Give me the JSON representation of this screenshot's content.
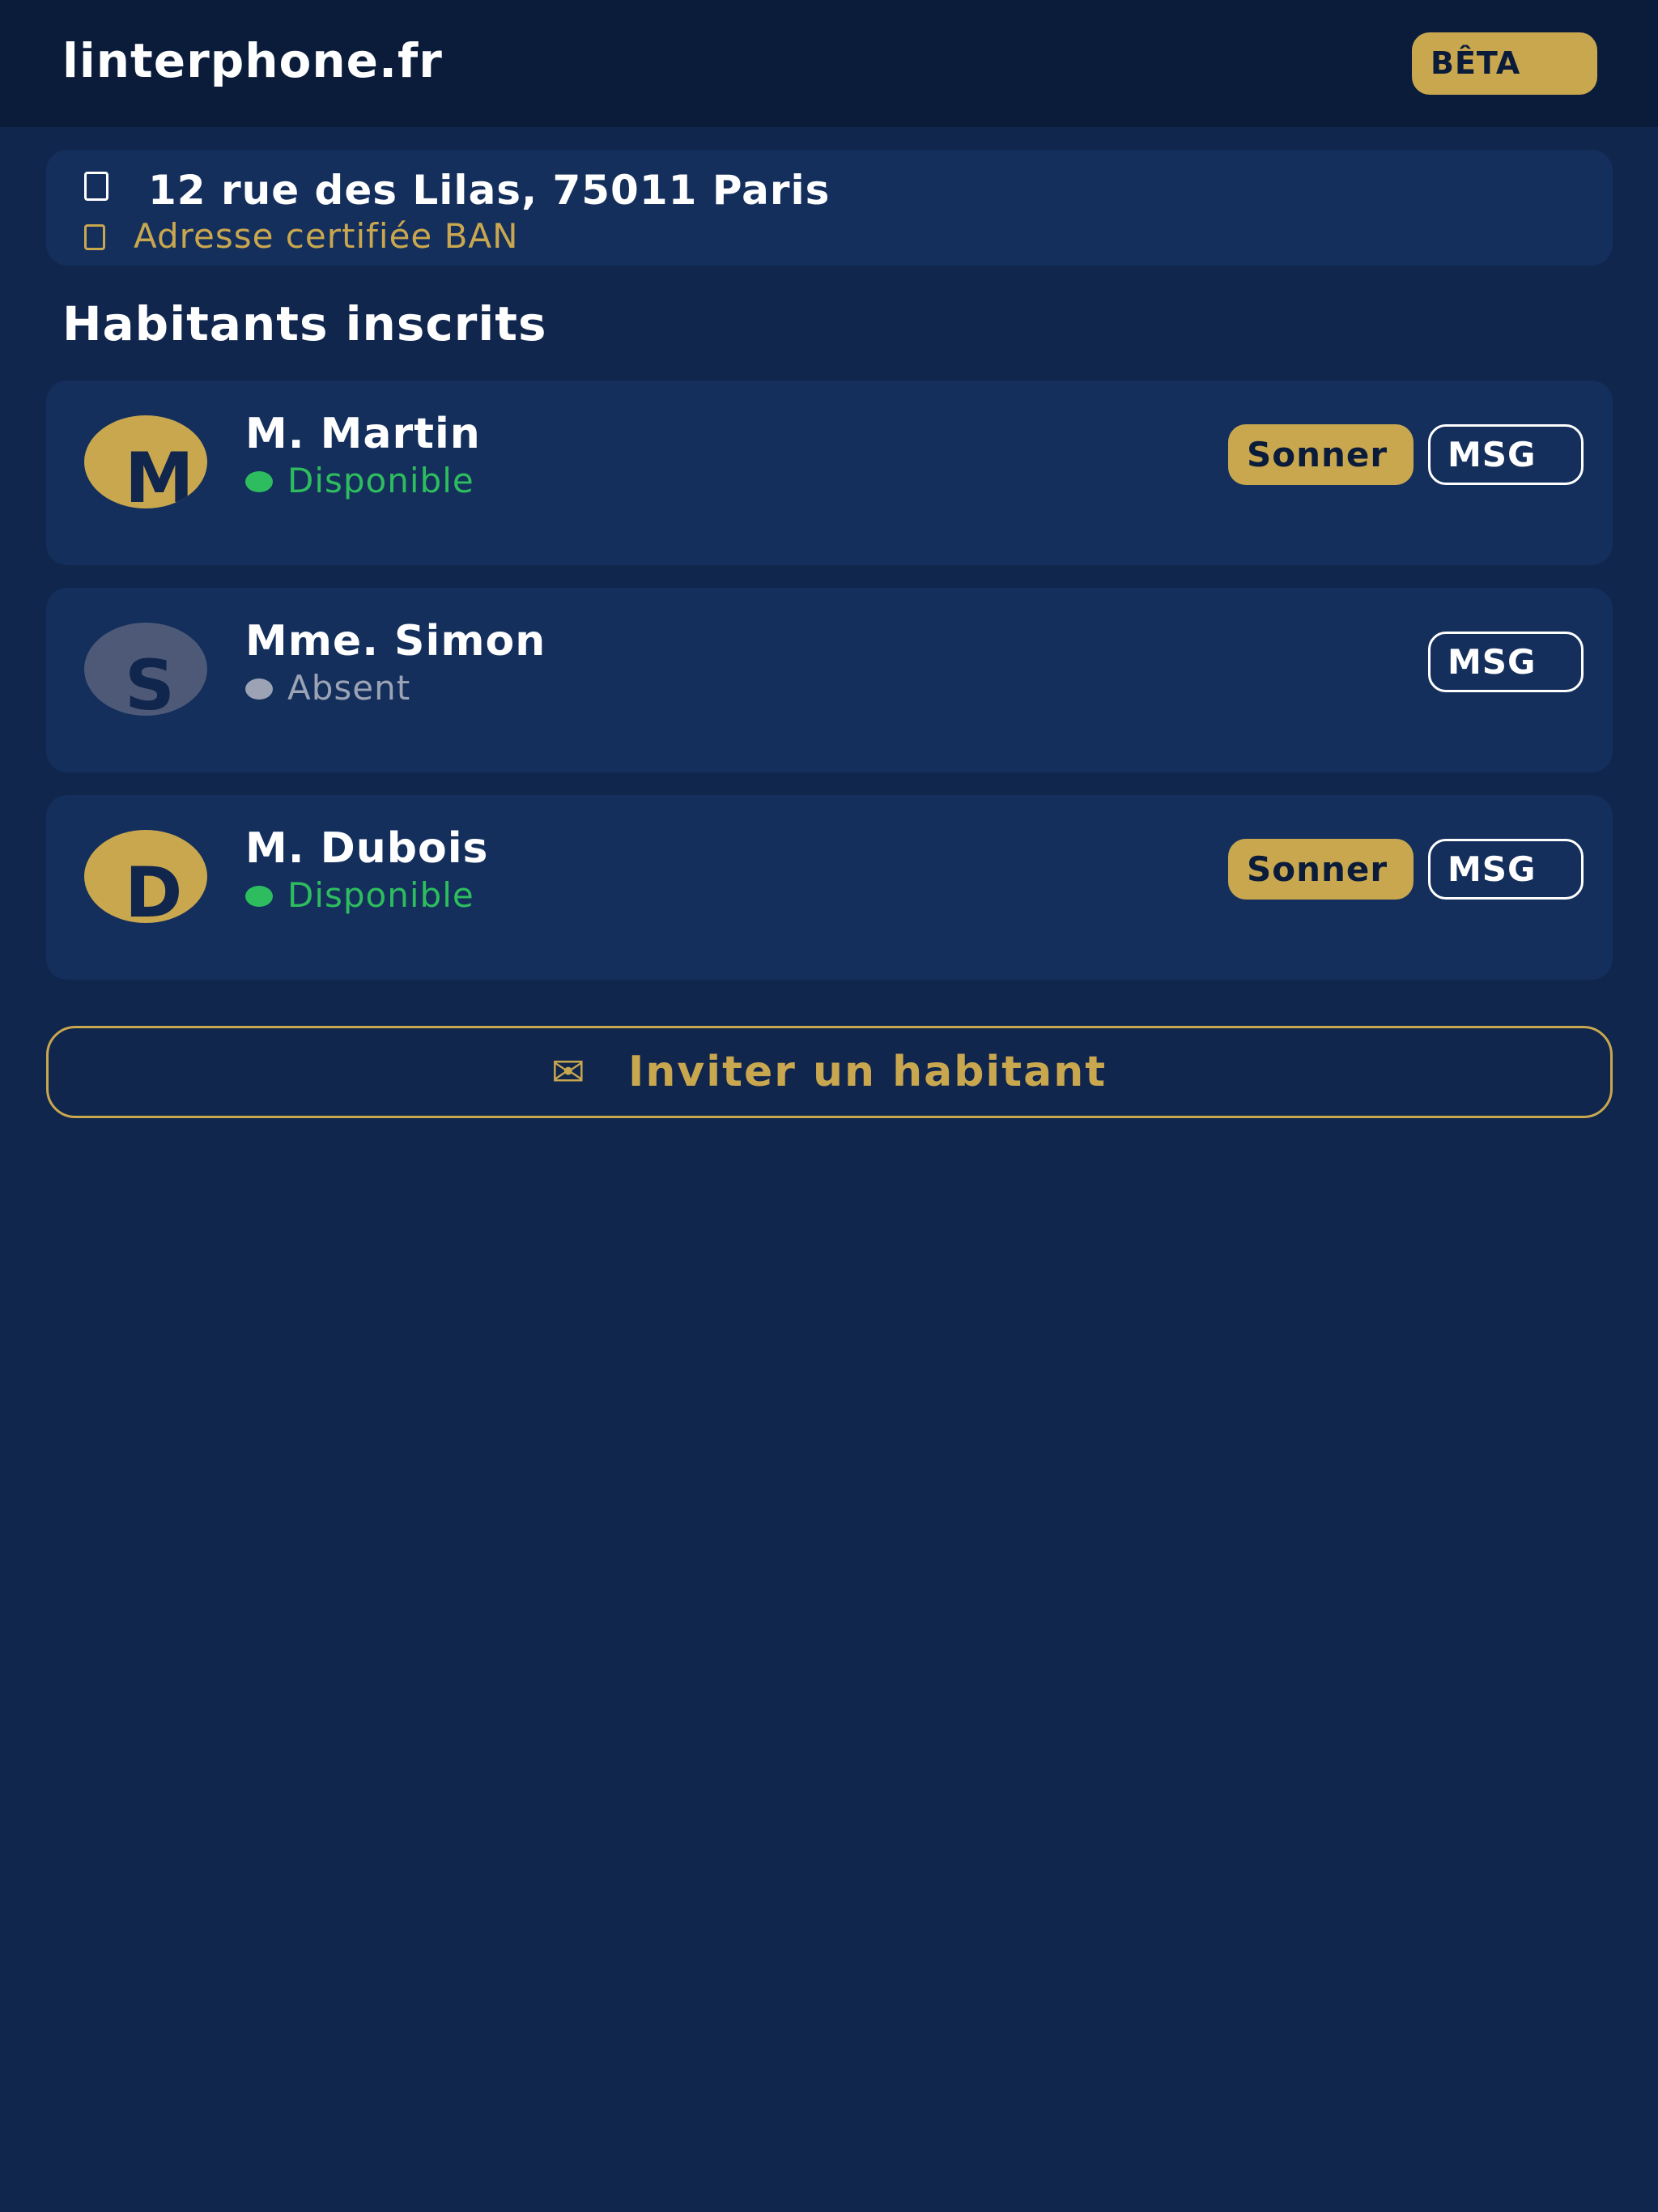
{
  "header": {
    "app_title": "linterphone.fr",
    "badge": "BÊTA"
  },
  "address": {
    "icon": "map-pin-icon",
    "text": "12 rue des Lilas, 75011 Paris",
    "certified_icon": "certified-icon",
    "certified_text": "Adresse certifiée BAN"
  },
  "section_title": "Habitants inscrits",
  "residents": [
    {
      "initial": "M",
      "name": "M. Martin",
      "status": "Disponible",
      "ring_label": "Sonner",
      "msg_label": "MSG"
    },
    {
      "initial": "S",
      "name": "Mme. Simon",
      "status": "Absent",
      "msg_label": "MSG"
    },
    {
      "initial": "D",
      "name": "M. Dubois",
      "status": "Disponible",
      "ring_label": "Sonner",
      "msg_label": "MSG"
    }
  ],
  "invite": {
    "icon": "✉",
    "label": "Inviter un habitant"
  },
  "colors": {
    "background": "#10264d",
    "header": "#0b1c3b",
    "card": "#142f5c",
    "accent_gold": "#c9a74f",
    "available_green": "#2ebd5e",
    "absent_grey": "#9ba3b5"
  }
}
